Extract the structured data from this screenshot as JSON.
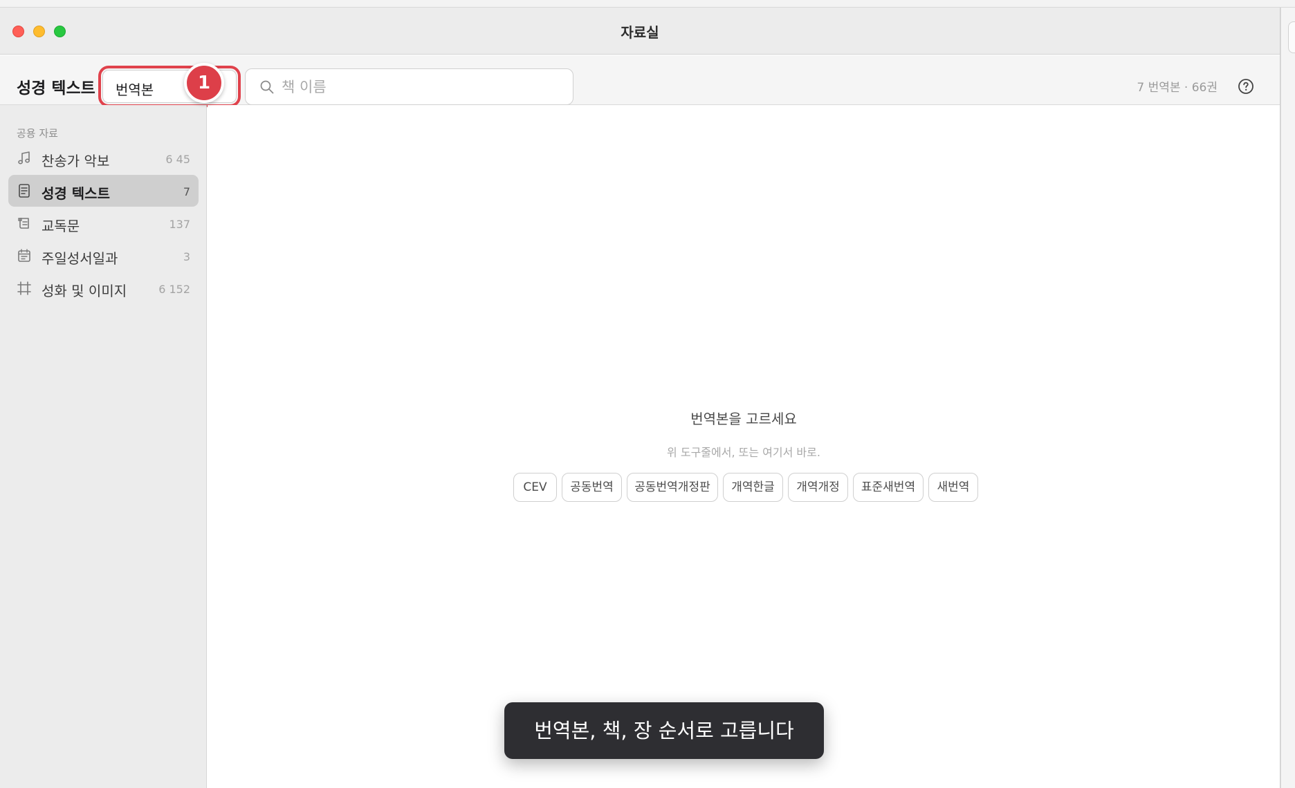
{
  "window": {
    "title": "자료실"
  },
  "toolbar": {
    "section_title": "성경 텍스트",
    "translation_select_value": "번역본",
    "search_placeholder": "책 이름",
    "summary": "7 번역본 · 66권",
    "step_badge": "1"
  },
  "sidebar": {
    "header": "공용 자료",
    "items": [
      {
        "label": "찬송가 악보",
        "count": "6 45",
        "icon": "music-note-icon"
      },
      {
        "label": "성경 텍스트",
        "count": "7",
        "icon": "document-icon",
        "active": true
      },
      {
        "label": "교독문",
        "count": "137",
        "icon": "scroll-icon"
      },
      {
        "label": "주일성서일과",
        "count": "3",
        "icon": "calendar-icon"
      },
      {
        "label": "성화 및 이미지",
        "count": "6 152",
        "icon": "frame-icon"
      }
    ]
  },
  "main": {
    "empty_title": "번역본을 고르세요",
    "empty_subtitle": "위 도구줄에서, 또는 여기서 바로.",
    "translations": [
      "CEV",
      "공동번역",
      "공동번역개정판",
      "개역한글",
      "개역개정",
      "표준새번역",
      "새번역"
    ]
  },
  "toast": {
    "text": "번역본, 책, 장 순서로 고릅니다"
  },
  "colors": {
    "highlight": "#e0424c",
    "badge": "#dd3f49",
    "toast_bg": "#2e2e32",
    "sidebar_active": "#cfcfcf"
  }
}
